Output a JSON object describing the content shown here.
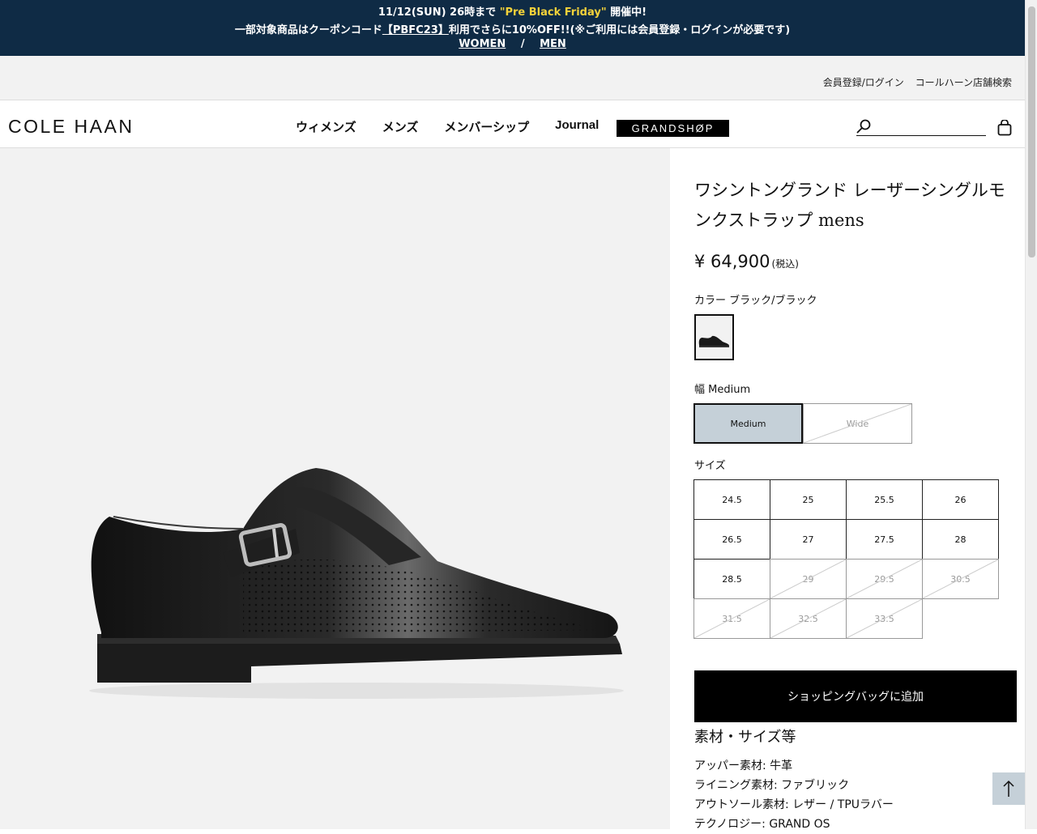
{
  "promo": {
    "line1_prefix": "11/12(SUN) 26時まで",
    "line1_highlight": "\"Pre Black Friday\"",
    "line1_suffix": "開催中!",
    "line2_prefix": "一部対象商品はクーポンコード",
    "line2_code": "【PBFC23】",
    "line2_suffix": "利用でさらに10%OFF!!(※ご利用には会員登録・ログインが必要です)",
    "women_link": "WOMEN",
    "separator": "/",
    "men_link": "MEN",
    "background": "#0f2b45",
    "highlight_color": "#f4d23a"
  },
  "utility": {
    "login": "会員登録/ログイン",
    "store_search": "コールハーン店舗検索"
  },
  "header": {
    "logo": "COLE HAAN",
    "menu": [
      "ウィメンズ",
      "メンズ",
      "メンバーシップ",
      "Journal"
    ],
    "grandshop": "GRANDSHØP",
    "search_placeholder": ""
  },
  "product": {
    "title": "ワシントングランド レーザーシングルモンクストラップ mens",
    "price": "¥ 64,900",
    "tax_note": "(税込)",
    "color_label": "カラー ブラック/ブラック",
    "width_label": "幅 Medium",
    "widths": [
      {
        "label": "Medium",
        "state": "selected"
      },
      {
        "label": "Wide",
        "state": "disabled"
      }
    ],
    "size_label": "サイズ",
    "sizes": [
      {
        "label": "24.5",
        "available": true
      },
      {
        "label": "25",
        "available": true
      },
      {
        "label": "25.5",
        "available": true
      },
      {
        "label": "26",
        "available": true
      },
      {
        "label": "26.5",
        "available": true
      },
      {
        "label": "27",
        "available": true
      },
      {
        "label": "27.5",
        "available": true
      },
      {
        "label": "28",
        "available": true
      },
      {
        "label": "28.5",
        "available": true
      },
      {
        "label": "29",
        "available": false
      },
      {
        "label": "29.5",
        "available": false
      },
      {
        "label": "30.5",
        "available": false
      },
      {
        "label": "31.5",
        "available": false
      },
      {
        "label": "32.5",
        "available": false
      },
      {
        "label": "33.5",
        "available": false
      }
    ],
    "add_to_bag": "ショッピングバッグに追加",
    "spec_title": "素材・サイズ等",
    "specs": [
      "アッパー素材: 牛革",
      "ライニング素材: ファブリック",
      "アウトソール素材: レザー / TPUラバー",
      "テクノロジー: GRAND OS"
    ]
  },
  "icons": {
    "search": "search-icon",
    "bag": "shopping-bag-icon",
    "to_top": "arrow-up-icon"
  }
}
